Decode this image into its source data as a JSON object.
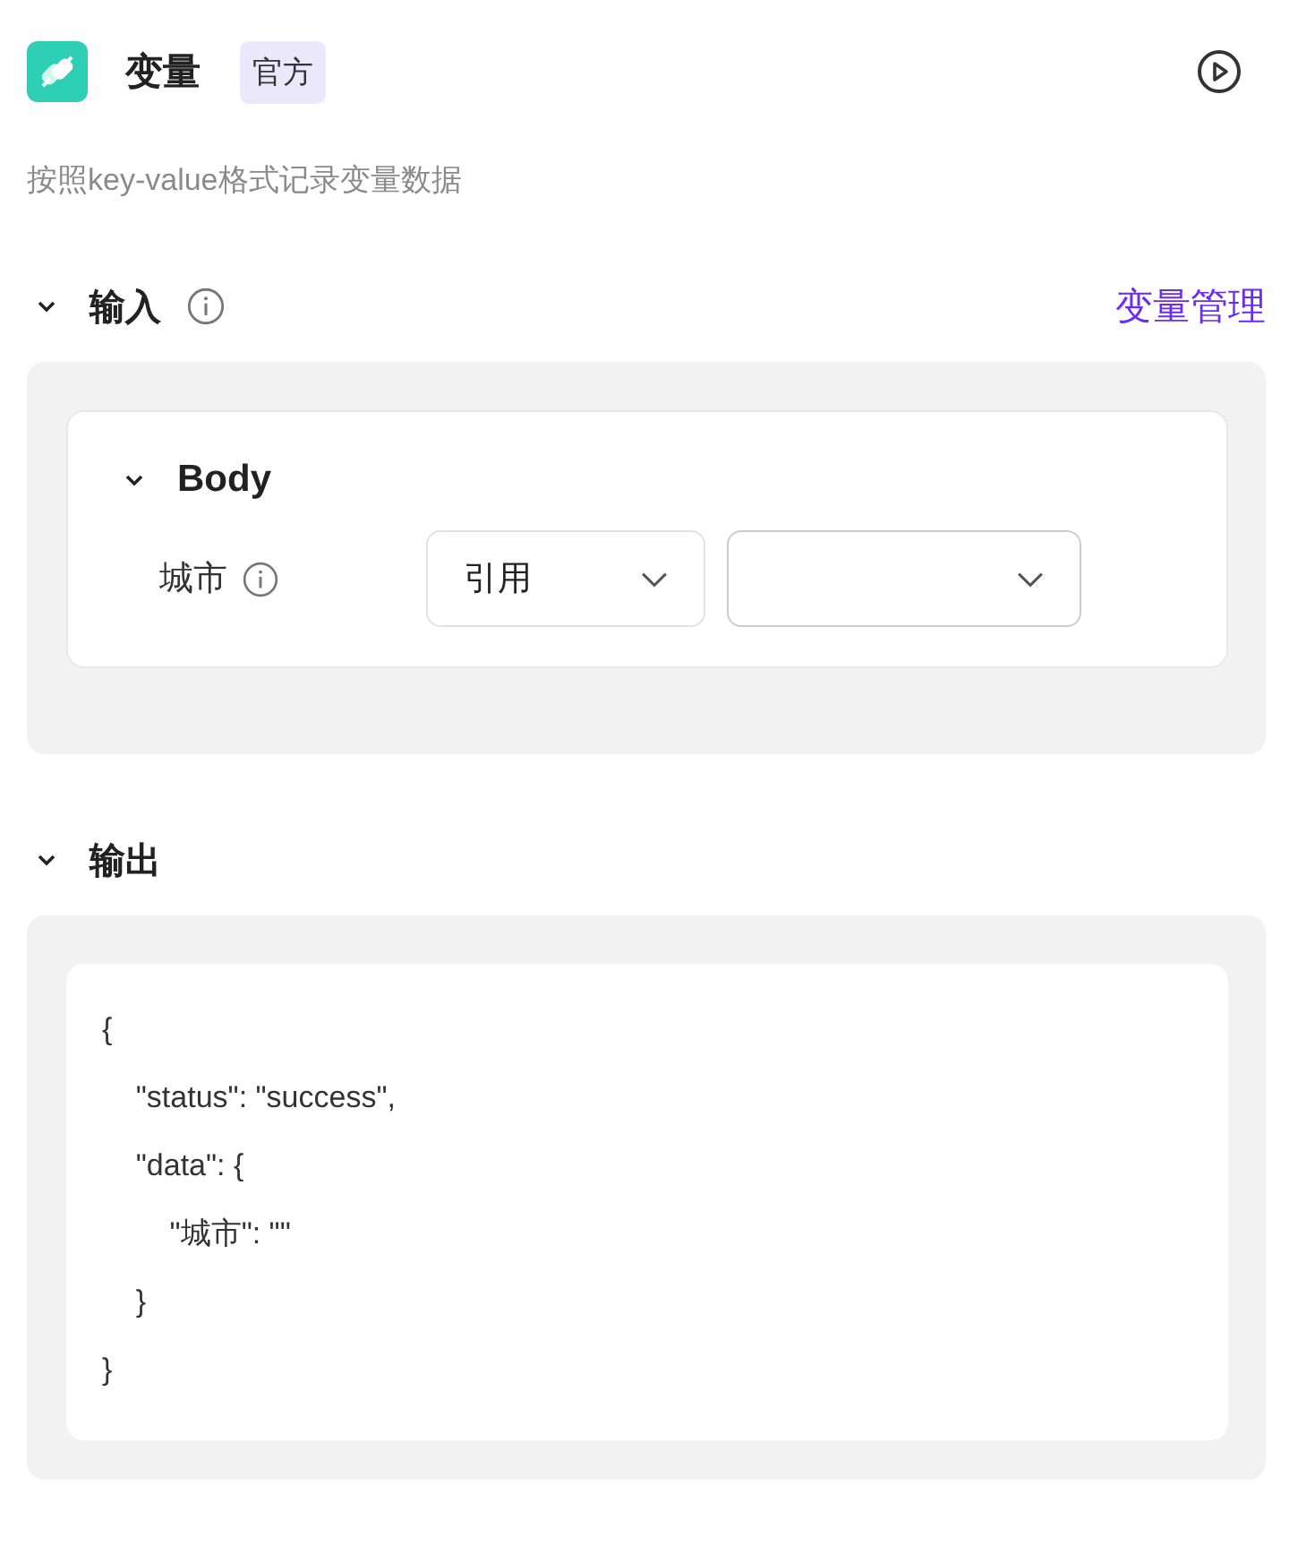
{
  "header": {
    "title": "变量",
    "badge": "官方",
    "description": "按照key-value格式记录变量数据"
  },
  "input": {
    "title": "输入",
    "expanded": true,
    "link": "变量管理",
    "group": {
      "title": "Body",
      "expanded": true,
      "fields": [
        {
          "label": "城市",
          "mode": "引用"
        }
      ]
    }
  },
  "output": {
    "title": "输出",
    "expanded": true,
    "code": "{\n    \"status\": \"success\",\n    \"data\": {\n        \"城市\": \"\"\n    }\n}"
  }
}
